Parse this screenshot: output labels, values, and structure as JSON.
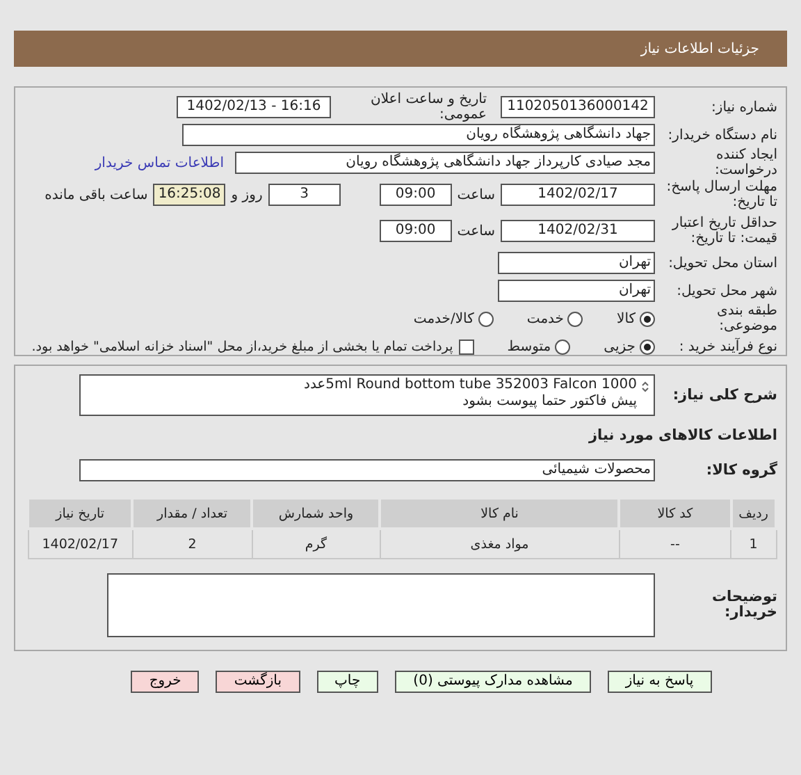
{
  "header": {
    "title": "جزئیات اطلاعات نیاز"
  },
  "need": {
    "number": {
      "label": "شماره نیاز:",
      "value": "1102050136000142"
    },
    "announce": {
      "label": "تاریخ و ساعت اعلان عمومی:",
      "value": "1402/02/13 - 16:16"
    },
    "buyer": {
      "label": "نام دستگاه خریدار:",
      "value": "جهاد دانشگاهی پژوهشگاه رویان"
    },
    "creator": {
      "label": "ایجاد کننده درخواست:",
      "value": "مجد صیادی کارپرداز جهاد دانشگاهی پژوهشگاه رویان",
      "link": "اطلاعات تماس خریدار"
    },
    "deadline": {
      "label": "مهلت ارسال پاسخ: تا تاریخ:",
      "date": "1402/02/17",
      "time_label": "ساعت",
      "time": "09:00",
      "days": "3",
      "days_label": "روز و",
      "remaining": "16:25:08",
      "remaining_label": "ساعت باقی مانده"
    },
    "validity": {
      "label": "حداقل تاریخ اعتبار قیمت: تا تاریخ:",
      "date": "1402/02/31",
      "time_label": "ساعت",
      "time": "09:00"
    },
    "province": {
      "label": "استان محل تحویل:",
      "value": "تهران"
    },
    "city": {
      "label": "شهر محل تحویل:",
      "value": "تهران"
    },
    "category": {
      "label": "طبقه بندی موضوعی:",
      "options": [
        {
          "label": "کالا",
          "selected": true
        },
        {
          "label": "خدمت",
          "selected": false
        },
        {
          "label": "کالا/خدمت",
          "selected": false
        }
      ]
    },
    "process": {
      "label": "نوع فرآیند خرید :",
      "options": [
        {
          "label": "جزیی",
          "selected": true
        },
        {
          "label": "متوسط",
          "selected": false
        }
      ],
      "treasury": {
        "label": "پرداخت تمام یا بخشی از مبلغ خرید،از محل \"اسناد خزانه اسلامی\" خواهد بود.",
        "checked": false
      }
    }
  },
  "items": {
    "description": {
      "label": "شرح کلی نیاز:",
      "lines": [
        "5ml Round bottom tube 352003 Falcon  1000عدد",
        "پیش فاکتور حتما پیوست بشود"
      ]
    },
    "heading": "اطلاعات کالاهای مورد نیاز",
    "group": {
      "label": "گروه کالا:",
      "value": "محصولات شیمیائی"
    },
    "table": {
      "columns": [
        "ردیف",
        "کد کالا",
        "نام کالا",
        "واحد شمارش",
        "تعداد / مقدار",
        "تاریخ نیاز"
      ],
      "rows": [
        [
          "1",
          "--",
          "مواد مغذی",
          "گرم",
          "2",
          "1402/02/17"
        ]
      ]
    },
    "notes": {
      "label": "توضیحات خریدار:"
    }
  },
  "buttons": [
    {
      "label": "پاسخ به نیاز",
      "kind": "primary"
    },
    {
      "label": "مشاهده مدارک پیوستی (0)",
      "kind": "primary"
    },
    {
      "label": "چاپ",
      "kind": "primary"
    },
    {
      "label": "بازگشت",
      "kind": "danger"
    },
    {
      "label": "خروج",
      "kind": "danger"
    }
  ]
}
